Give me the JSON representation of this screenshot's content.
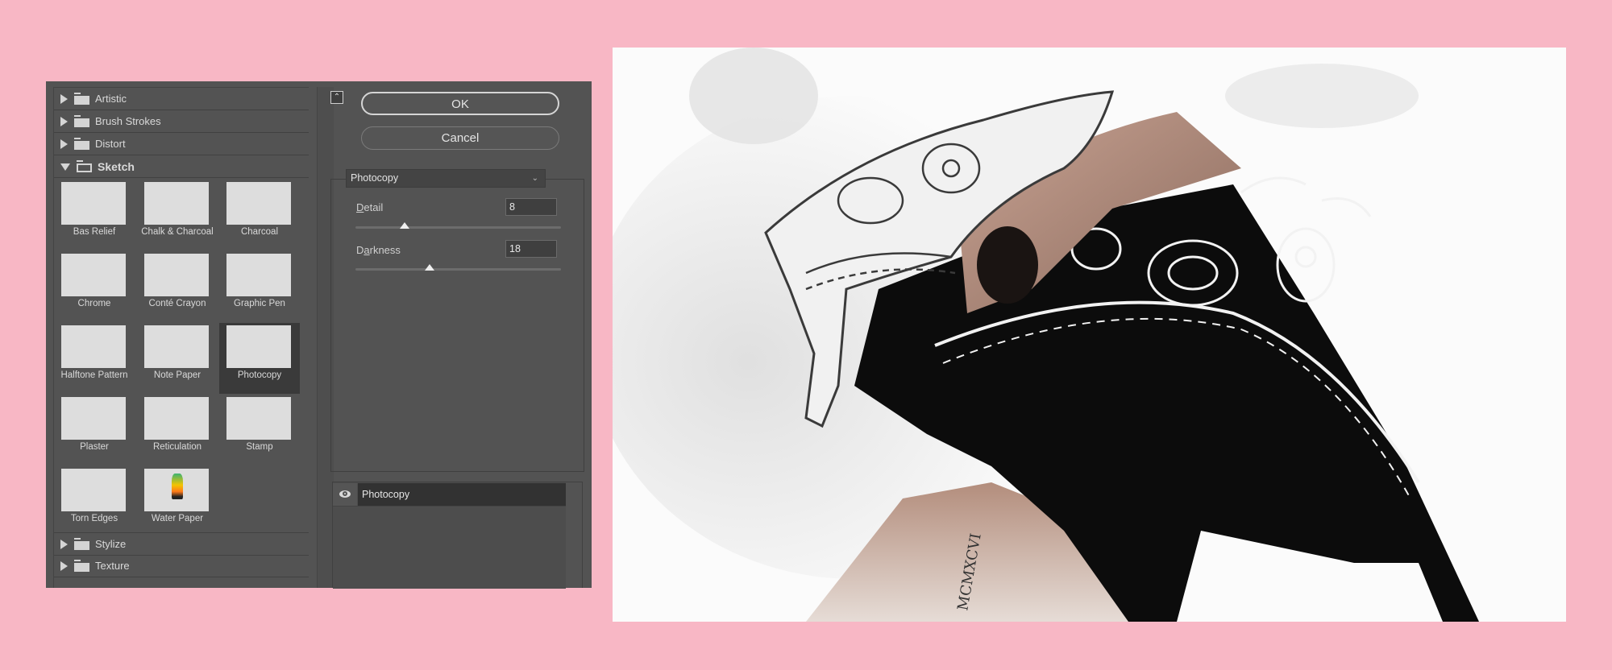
{
  "dialog": {
    "categories_top": [
      {
        "label": "Artistic",
        "expanded": false
      },
      {
        "label": "Brush Strokes",
        "expanded": false
      },
      {
        "label": "Distort",
        "expanded": false
      },
      {
        "label": "Sketch",
        "expanded": true
      }
    ],
    "sketch_filters": [
      {
        "label": "Bas Relief",
        "selected": false
      },
      {
        "label": "Chalk & Charcoal",
        "selected": false
      },
      {
        "label": "Charcoal",
        "selected": false
      },
      {
        "label": "Chrome",
        "selected": false
      },
      {
        "label": "Conté Crayon",
        "selected": false
      },
      {
        "label": "Graphic Pen",
        "selected": false
      },
      {
        "label": "Halftone Pattern",
        "selected": false
      },
      {
        "label": "Note Paper",
        "selected": false
      },
      {
        "label": "Photocopy",
        "selected": true
      },
      {
        "label": "Plaster",
        "selected": false
      },
      {
        "label": "Reticulation",
        "selected": false
      },
      {
        "label": "Stamp",
        "selected": false
      },
      {
        "label": "Torn Edges",
        "selected": false
      },
      {
        "label": "Water Paper",
        "selected": false
      }
    ],
    "categories_bottom": [
      {
        "label": "Stylize",
        "expanded": false
      },
      {
        "label": "Texture",
        "expanded": false
      }
    ],
    "buttons": {
      "ok": "OK",
      "cancel": "Cancel",
      "collapse_icon": "⌃"
    },
    "filter_select": {
      "value": "Photocopy"
    },
    "params": [
      {
        "label_pre": "",
        "label_ul": "D",
        "label_post": "etail",
        "value": "8",
        "slider_fraction": 0.24
      },
      {
        "label_pre": "D",
        "label_ul": "a",
        "label_post": "rkness",
        "value": "18",
        "slider_fraction": 0.36
      }
    ],
    "layers": [
      {
        "name": "Photocopy",
        "visible": true
      }
    ]
  },
  "preview": {
    "description": "Photocopy-filtered artwork of a person wearing bandanas",
    "tattoo_text": "MCMXCVI"
  }
}
